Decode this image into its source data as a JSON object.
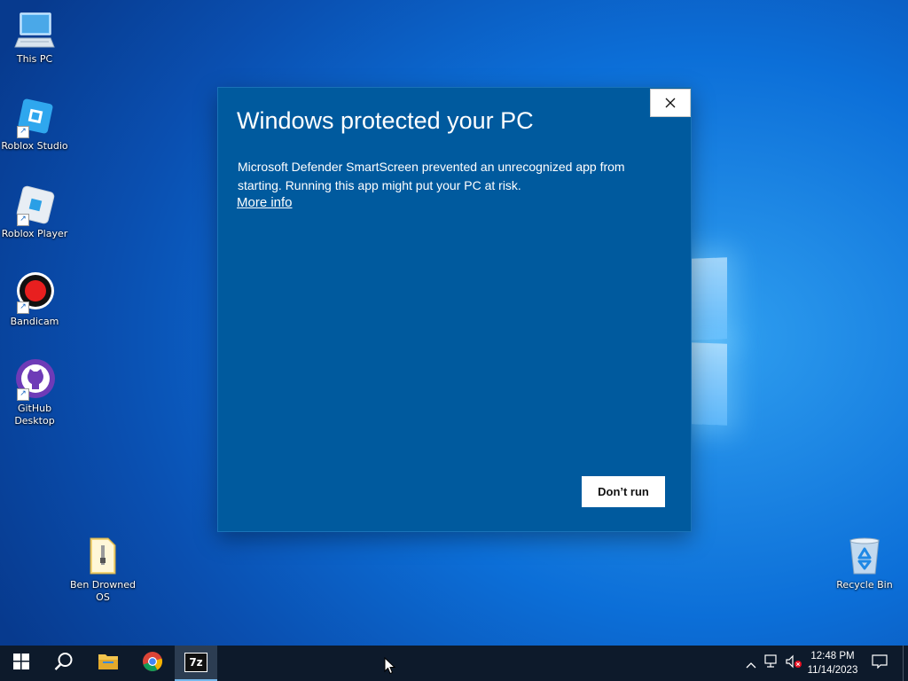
{
  "desktop": {
    "icons": [
      {
        "label": "This PC"
      },
      {
        "label": "Roblox Studio"
      },
      {
        "label": "Roblox Player"
      },
      {
        "label": "Bandicam"
      },
      {
        "label": "GitHub Desktop"
      },
      {
        "label": "Ben Drowned OS"
      },
      {
        "label": "Recycle Bin"
      }
    ]
  },
  "dialog": {
    "title": "Windows protected your PC",
    "body": "Microsoft Defender SmartScreen prevented an unrecognized app from starting. Running this app might put your PC at risk.",
    "more_info": "More info",
    "dont_run": "Don’t run",
    "close_icon": "close-icon"
  },
  "taskbar": {
    "items": [
      "windows-logo-icon",
      "search-icon",
      "file-explorer-icon",
      "chrome-icon",
      "7zip-icon"
    ],
    "seven_zip_label": "7z",
    "active_item": "7zip",
    "tray_icons": [
      "chevron-up-icon",
      "network-icon",
      "volume-muted-icon",
      "notification-icon"
    ],
    "time": "12:48 PM",
    "date": "11/14/2023"
  },
  "colors": {
    "dialog_bg": "#005a9e",
    "taskbar_bg": "#0d1a2b",
    "accent": "#76b9ed"
  }
}
